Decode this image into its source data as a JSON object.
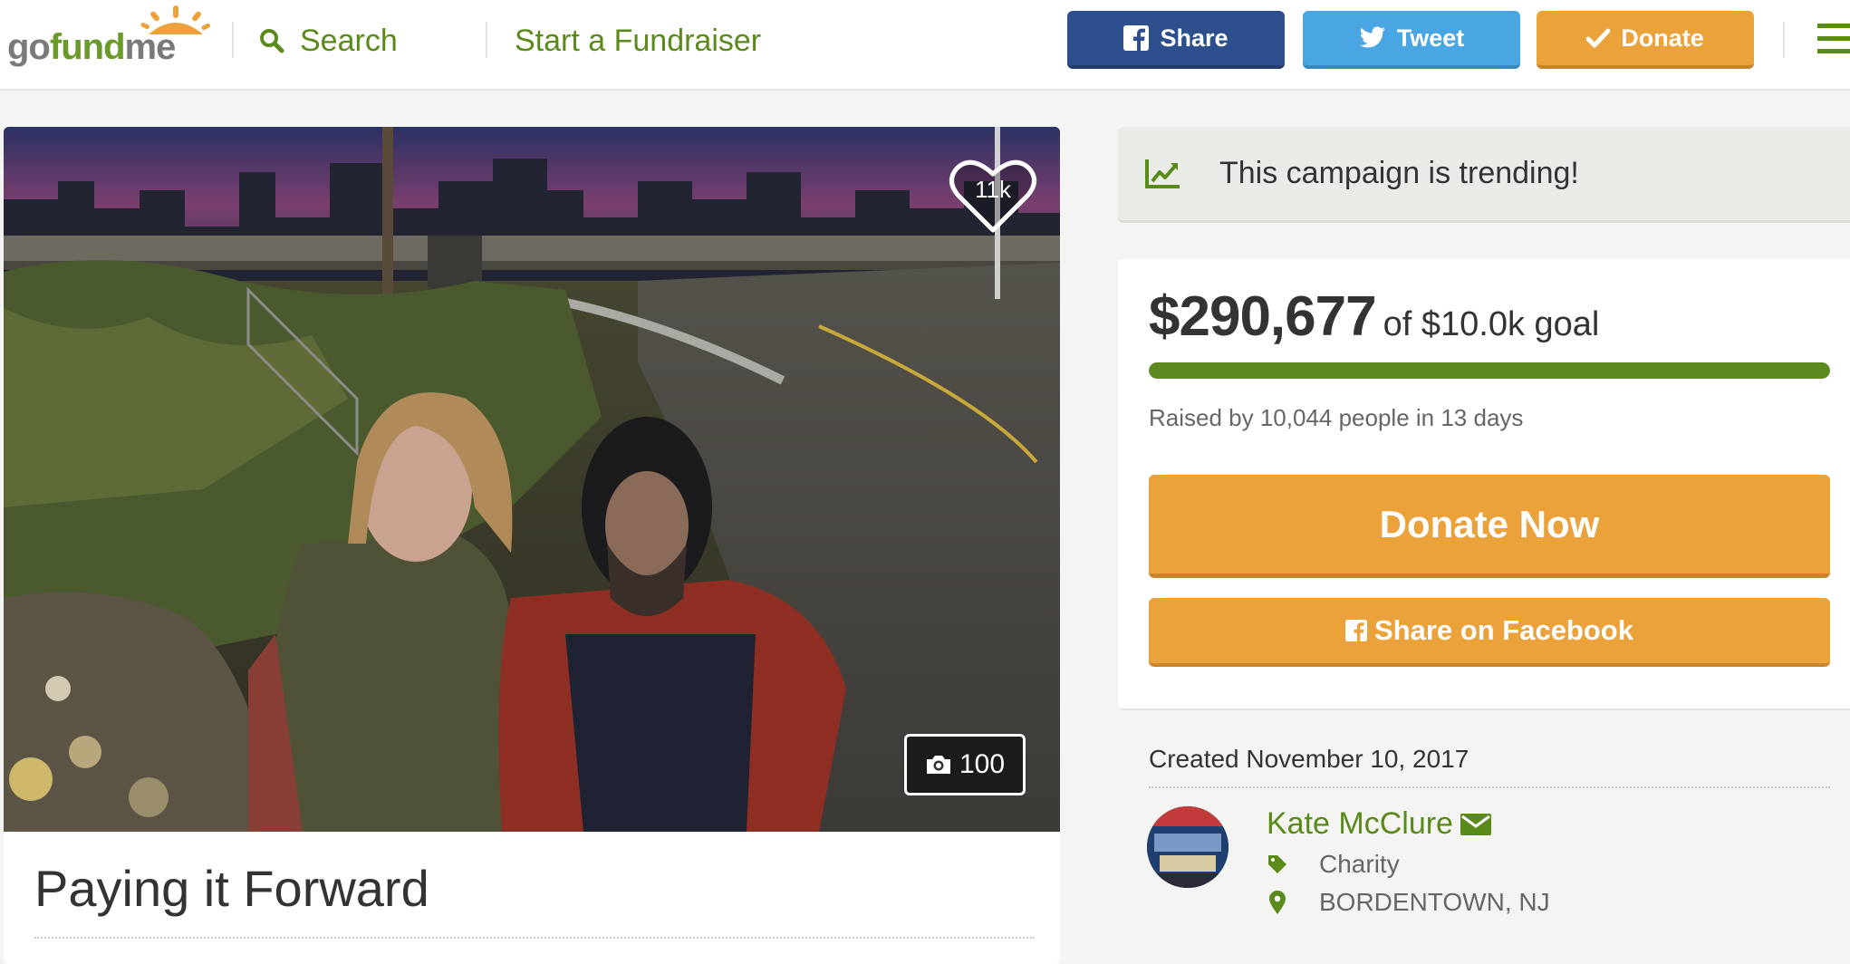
{
  "header": {
    "logo_text_1": "go",
    "logo_text_2": "fund",
    "logo_text_3": "me",
    "search_label": "Search",
    "start_label": "Start a Fundraiser",
    "share_label": "Share",
    "tweet_label": "Tweet",
    "donate_label": "Donate"
  },
  "colors": {
    "brand_green": "#5a8a1a",
    "facebook_blue": "#2d4f8e",
    "twitter_blue": "#4aa6e2",
    "donate_orange": "#eba23b"
  },
  "photo": {
    "heart_count": "11k",
    "photo_count": "100"
  },
  "campaign": {
    "title": "Paying it Forward"
  },
  "trending": {
    "text": "This campaign is trending!",
    "icon": "trend-chart-icon"
  },
  "funding": {
    "amount": "$290,677",
    "goal_text": "of $10.0k goal",
    "progress_fraction": 1.0,
    "raised_by": "Raised by 10,044 people in 13 days",
    "donate_now_label": "Donate Now",
    "share_facebook_label": "Share on Facebook"
  },
  "organizer": {
    "created": "Created November 10, 2017",
    "name": "Kate McClure",
    "category": "Charity",
    "location": "BORDENTOWN, NJ"
  }
}
